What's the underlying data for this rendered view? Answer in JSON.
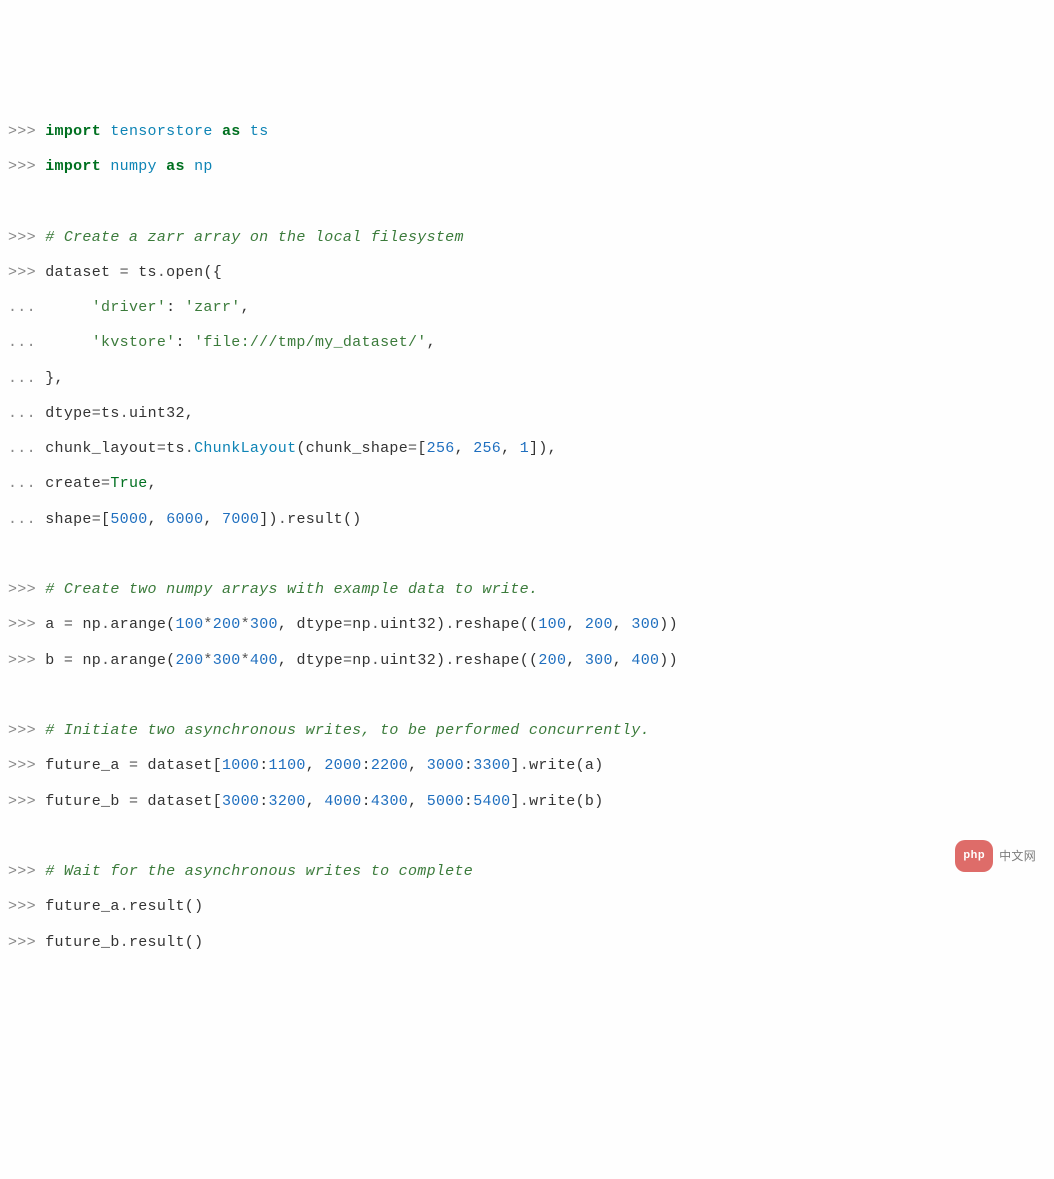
{
  "colors": {
    "keyword": "#007020",
    "module": "#0e84b5",
    "string": "#3b7b3b",
    "number": "#1f6fbf",
    "comment": "#3b7b3b",
    "prompt": "#888888",
    "text": "#333333"
  },
  "lines": [
    {
      "prompt": ">>>",
      "tokens": [
        {
          "t": "import",
          "c": "kw"
        },
        {
          "t": " "
        },
        {
          "t": "tensorstore",
          "c": "nn"
        },
        {
          "t": " "
        },
        {
          "t": "as",
          "c": "kw"
        },
        {
          "t": " "
        },
        {
          "t": "ts",
          "c": "nn"
        }
      ]
    },
    {
      "prompt": ">>>",
      "tokens": [
        {
          "t": "import",
          "c": "kw"
        },
        {
          "t": " "
        },
        {
          "t": "numpy",
          "c": "nn"
        },
        {
          "t": " "
        },
        {
          "t": "as",
          "c": "kw"
        },
        {
          "t": " "
        },
        {
          "t": "np",
          "c": "nn"
        }
      ]
    },
    {
      "blank": true
    },
    {
      "prompt": ">>>",
      "tokens": [
        {
          "t": "# Create a zarr array on the local filesystem",
          "c": "cm"
        }
      ]
    },
    {
      "prompt": ">>>",
      "tokens": [
        {
          "t": "dataset "
        },
        {
          "t": "=",
          "c": "op"
        },
        {
          "t": " ts"
        },
        {
          "t": ".",
          "c": "op"
        },
        {
          "t": "open"
        },
        {
          "t": "({",
          "c": "punc"
        }
      ]
    },
    {
      "prompt": "...",
      "tokens": [
        {
          "t": "     "
        },
        {
          "t": "'driver'",
          "c": "str"
        },
        {
          "t": ": "
        },
        {
          "t": "'zarr'",
          "c": "str"
        },
        {
          "t": ",",
          "c": "punc"
        }
      ]
    },
    {
      "prompt": "...",
      "tokens": [
        {
          "t": "     "
        },
        {
          "t": "'kvstore'",
          "c": "str"
        },
        {
          "t": ": "
        },
        {
          "t": "'file:///tmp/my_dataset/'",
          "c": "str"
        },
        {
          "t": ",",
          "c": "punc"
        }
      ]
    },
    {
      "prompt": "...",
      "tokens": [
        {
          "t": "},",
          "c": "punc"
        }
      ]
    },
    {
      "prompt": "...",
      "tokens": [
        {
          "t": "dtype"
        },
        {
          "t": "=",
          "c": "op"
        },
        {
          "t": "ts"
        },
        {
          "t": ".",
          "c": "op"
        },
        {
          "t": "uint32"
        },
        {
          "t": ",",
          "c": "punc"
        }
      ]
    },
    {
      "prompt": "...",
      "tokens": [
        {
          "t": "chunk_layout"
        },
        {
          "t": "=",
          "c": "op"
        },
        {
          "t": "ts"
        },
        {
          "t": ".",
          "c": "op"
        },
        {
          "t": "ChunkLayout",
          "c": "cls"
        },
        {
          "t": "(",
          "c": "punc"
        },
        {
          "t": "chunk_shape"
        },
        {
          "t": "=",
          "c": "op"
        },
        {
          "t": "[",
          "c": "punc"
        },
        {
          "t": "256",
          "c": "num"
        },
        {
          "t": ", ",
          "c": "punc"
        },
        {
          "t": "256",
          "c": "num"
        },
        {
          "t": ", ",
          "c": "punc"
        },
        {
          "t": "1",
          "c": "num"
        },
        {
          "t": "]),",
          "c": "punc"
        }
      ]
    },
    {
      "prompt": "...",
      "tokens": [
        {
          "t": "create"
        },
        {
          "t": "=",
          "c": "op"
        },
        {
          "t": "True",
          "c": "const"
        },
        {
          "t": ",",
          "c": "punc"
        }
      ]
    },
    {
      "prompt": "...",
      "tokens": [
        {
          "t": "shape"
        },
        {
          "t": "=",
          "c": "op"
        },
        {
          "t": "[",
          "c": "punc"
        },
        {
          "t": "5000",
          "c": "num"
        },
        {
          "t": ", ",
          "c": "punc"
        },
        {
          "t": "6000",
          "c": "num"
        },
        {
          "t": ", ",
          "c": "punc"
        },
        {
          "t": "7000",
          "c": "num"
        },
        {
          "t": "])",
          "c": "punc"
        },
        {
          "t": ".",
          "c": "op"
        },
        {
          "t": "result"
        },
        {
          "t": "()",
          "c": "punc"
        }
      ]
    },
    {
      "blank": true
    },
    {
      "prompt": ">>>",
      "tokens": [
        {
          "t": "# Create two numpy arrays with example data to write.",
          "c": "cm"
        }
      ]
    },
    {
      "prompt": ">>>",
      "tokens": [
        {
          "t": "a "
        },
        {
          "t": "=",
          "c": "op"
        },
        {
          "t": " np"
        },
        {
          "t": ".",
          "c": "op"
        },
        {
          "t": "arange"
        },
        {
          "t": "(",
          "c": "punc"
        },
        {
          "t": "100",
          "c": "num"
        },
        {
          "t": "*",
          "c": "op"
        },
        {
          "t": "200",
          "c": "num"
        },
        {
          "t": "*",
          "c": "op"
        },
        {
          "t": "300",
          "c": "num"
        },
        {
          "t": ", ",
          "c": "punc"
        },
        {
          "t": "dtype"
        },
        {
          "t": "=",
          "c": "op"
        },
        {
          "t": "np"
        },
        {
          "t": ".",
          "c": "op"
        },
        {
          "t": "uint32"
        },
        {
          "t": ")",
          "c": "punc"
        },
        {
          "t": ".",
          "c": "op"
        },
        {
          "t": "reshape"
        },
        {
          "t": "((",
          "c": "punc"
        },
        {
          "t": "100",
          "c": "num"
        },
        {
          "t": ", ",
          "c": "punc"
        },
        {
          "t": "200",
          "c": "num"
        },
        {
          "t": ", ",
          "c": "punc"
        },
        {
          "t": "300",
          "c": "num"
        },
        {
          "t": "))",
          "c": "punc"
        }
      ]
    },
    {
      "prompt": ">>>",
      "tokens": [
        {
          "t": "b "
        },
        {
          "t": "=",
          "c": "op"
        },
        {
          "t": " np"
        },
        {
          "t": ".",
          "c": "op"
        },
        {
          "t": "arange"
        },
        {
          "t": "(",
          "c": "punc"
        },
        {
          "t": "200",
          "c": "num"
        },
        {
          "t": "*",
          "c": "op"
        },
        {
          "t": "300",
          "c": "num"
        },
        {
          "t": "*",
          "c": "op"
        },
        {
          "t": "400",
          "c": "num"
        },
        {
          "t": ", ",
          "c": "punc"
        },
        {
          "t": "dtype"
        },
        {
          "t": "=",
          "c": "op"
        },
        {
          "t": "np"
        },
        {
          "t": ".",
          "c": "op"
        },
        {
          "t": "uint32"
        },
        {
          "t": ")",
          "c": "punc"
        },
        {
          "t": ".",
          "c": "op"
        },
        {
          "t": "reshape"
        },
        {
          "t": "((",
          "c": "punc"
        },
        {
          "t": "200",
          "c": "num"
        },
        {
          "t": ", ",
          "c": "punc"
        },
        {
          "t": "300",
          "c": "num"
        },
        {
          "t": ", ",
          "c": "punc"
        },
        {
          "t": "400",
          "c": "num"
        },
        {
          "t": "))",
          "c": "punc"
        }
      ]
    },
    {
      "blank": true
    },
    {
      "prompt": ">>>",
      "tokens": [
        {
          "t": "# Initiate two asynchronous writes, to be performed concurrently.",
          "c": "cm"
        }
      ]
    },
    {
      "prompt": ">>>",
      "tokens": [
        {
          "t": "future_a "
        },
        {
          "t": "=",
          "c": "op"
        },
        {
          "t": " dataset"
        },
        {
          "t": "[",
          "c": "punc"
        },
        {
          "t": "1000",
          "c": "num"
        },
        {
          "t": ":",
          "c": "punc"
        },
        {
          "t": "1100",
          "c": "num"
        },
        {
          "t": ", ",
          "c": "punc"
        },
        {
          "t": "2000",
          "c": "num"
        },
        {
          "t": ":",
          "c": "punc"
        },
        {
          "t": "2200",
          "c": "num"
        },
        {
          "t": ", ",
          "c": "punc"
        },
        {
          "t": "3000",
          "c": "num"
        },
        {
          "t": ":",
          "c": "punc"
        },
        {
          "t": "3300",
          "c": "num"
        },
        {
          "t": "]",
          "c": "punc"
        },
        {
          "t": ".",
          "c": "op"
        },
        {
          "t": "write"
        },
        {
          "t": "(",
          "c": "punc"
        },
        {
          "t": "a"
        },
        {
          "t": ")",
          "c": "punc"
        }
      ]
    },
    {
      "prompt": ">>>",
      "tokens": [
        {
          "t": "future_b "
        },
        {
          "t": "=",
          "c": "op"
        },
        {
          "t": " dataset"
        },
        {
          "t": "[",
          "c": "punc"
        },
        {
          "t": "3000",
          "c": "num"
        },
        {
          "t": ":",
          "c": "punc"
        },
        {
          "t": "3200",
          "c": "num"
        },
        {
          "t": ", ",
          "c": "punc"
        },
        {
          "t": "4000",
          "c": "num"
        },
        {
          "t": ":",
          "c": "punc"
        },
        {
          "t": "4300",
          "c": "num"
        },
        {
          "t": ", ",
          "c": "punc"
        },
        {
          "t": "5000",
          "c": "num"
        },
        {
          "t": ":",
          "c": "punc"
        },
        {
          "t": "5400",
          "c": "num"
        },
        {
          "t": "]",
          "c": "punc"
        },
        {
          "t": ".",
          "c": "op"
        },
        {
          "t": "write"
        },
        {
          "t": "(",
          "c": "punc"
        },
        {
          "t": "b"
        },
        {
          "t": ")",
          "c": "punc"
        }
      ]
    },
    {
      "blank": true
    },
    {
      "prompt": ">>>",
      "tokens": [
        {
          "t": "# Wait for the asynchronous writes to complete",
          "c": "cm"
        }
      ]
    },
    {
      "prompt": ">>>",
      "tokens": [
        {
          "t": "future_a"
        },
        {
          "t": ".",
          "c": "op"
        },
        {
          "t": "result"
        },
        {
          "t": "()",
          "c": "punc"
        }
      ]
    },
    {
      "prompt": ">>>",
      "tokens": [
        {
          "t": "future_b"
        },
        {
          "t": ".",
          "c": "op"
        },
        {
          "t": "result"
        },
        {
          "t": "()",
          "c": "punc"
        }
      ]
    }
  ],
  "watermark": {
    "pill": "php",
    "text": "中文网"
  }
}
